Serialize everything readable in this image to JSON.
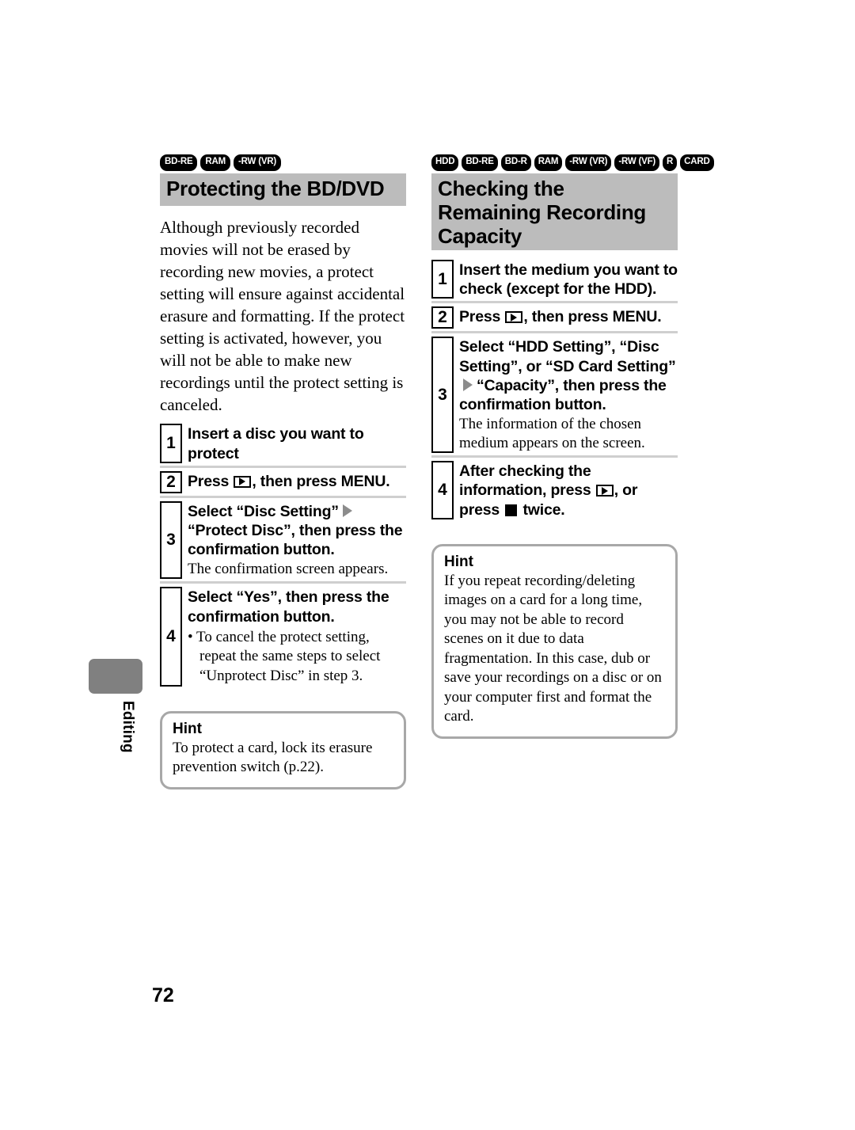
{
  "page": {
    "number": "72",
    "side_tab_label": "Editing"
  },
  "left_column": {
    "badges": [
      "BD-RE",
      "RAM",
      "-RW (VR)"
    ],
    "title": "Protecting the BD/DVD",
    "intro": "Although previously recorded movies will not be erased by recording new movies, a protect setting will ensure against accidental erasure and formatting. If the protect setting is activated, however, you will not be able to make new recordings until the protect setting is canceled.",
    "steps": [
      {
        "number": "1",
        "head_before": "Insert a disc you want to protect",
        "head_after": "",
        "sub": "",
        "bullet": ""
      },
      {
        "number": "2",
        "head_before": "Press ",
        "head_after": ", then press MENU.",
        "sub": "",
        "bullet": ""
      },
      {
        "number": "3",
        "head_before": "Select “Disc Setting”",
        "head_after": "“Protect Disc”, then press the confirmation button.",
        "sub": "The confirmation screen appears.",
        "bullet": ""
      },
      {
        "number": "4",
        "head_before": "Select “Yes”, then press the confirmation button.",
        "head_after": "",
        "sub": "",
        "bullet": "• To cancel the protect setting, repeat the same steps to select “Unprotect Disc” in step 3."
      }
    ],
    "hint": {
      "title": "Hint",
      "text": "To protect a card, lock its erasure prevention switch (p.22)."
    }
  },
  "right_column": {
    "badges": [
      "HDD",
      "BD-RE",
      "BD-R",
      "RAM",
      "-RW (VR)",
      "-RW (VF)",
      "R",
      "CARD"
    ],
    "title": "Checking the Remaining Recording Capacity",
    "steps": [
      {
        "number": "1",
        "head_before": "Insert the medium you want to check (except for the HDD).",
        "head_after": "",
        "sub": "",
        "bullet": ""
      },
      {
        "number": "2",
        "head_before": "Press ",
        "head_after": ", then press MENU.",
        "sub": "",
        "bullet": ""
      },
      {
        "number": "3",
        "head_before": "Select “HDD Setting”, “Disc Setting”, or “SD Card Setting”",
        "head_after": "“Capacity”, then press the confirmation button.",
        "sub": "The information of the chosen medium appears on the screen.",
        "bullet": ""
      },
      {
        "number": "4",
        "head_before": "After checking the information, press ",
        "head_middle": ", or press ",
        "head_after": " twice.",
        "sub": "",
        "bullet": ""
      }
    ],
    "hint": {
      "title": "Hint",
      "text": "If you repeat recording/deleting images on a card for a long time, you may not be able to record scenes on it due to data fragmentation. In this case, dub or save your recordings on a disc or on your computer first and format the card."
    }
  },
  "icons": {
    "play": "play-button-icon",
    "stop": "stop-button-icon",
    "arrow": "right-arrow-icon"
  },
  "colors": {
    "title_bar_bg": "#bcbcbc",
    "badge_bg": "#000000",
    "hint_border": "#a8a8a8",
    "side_tab": "#808080",
    "divider": "#cfcfcf"
  }
}
